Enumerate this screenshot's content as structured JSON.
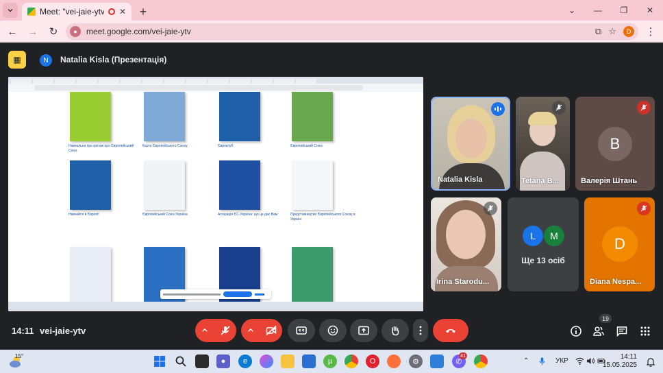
{
  "browser": {
    "tab_title": "Meet: \"vei-jaie-ytv\"",
    "url": "meet.google.com/vei-jaie-ytv",
    "profile_initial": "D"
  },
  "meet": {
    "presenter_initial": "N",
    "presenter_label": "Natalia Kisla (Презентація)",
    "time": "14:11",
    "meeting_code": "vei-jaie-ytv",
    "participant_count": "19"
  },
  "shared_screen": {
    "books": [
      {
        "label": "Навчальна гра орігамі про Європейський Союз",
        "color": "#9acd32"
      },
      {
        "label": "Карта Європейського Союзу",
        "color": "#7fa9d6"
      },
      {
        "label": "Євроклуб",
        "color": "#1f5fa8"
      },
      {
        "label": "Європейський Союз",
        "color": "#6aa84f"
      },
      {
        "label": "Навчайся в Європі!",
        "color": "#1f5fa8"
      },
      {
        "label": "Європейський Союз Україна",
        "color": "#f1f3f6"
      },
      {
        "label": "Асоціація ЄС-Україна: що це дає Вам",
        "color": "#1f4fa0"
      },
      {
        "label": "Представництво Європейського Союзу в Україні",
        "color": "#f4f6fa"
      },
      {
        "label": "",
        "color": "#e9eef6"
      },
      {
        "label": "",
        "color": "#2a6fc1"
      },
      {
        "label": "",
        "color": "#1a3f8c"
      },
      {
        "label": "",
        "color": "#3c9b6b"
      }
    ]
  },
  "participants": [
    {
      "name": "Natalia Kisla",
      "state": "speaking"
    },
    {
      "name": "Tetana B...",
      "state": "muted"
    },
    {
      "name": "Валерія Штань",
      "initial": "B",
      "state": "muted"
    },
    {
      "name": "Irina Starodu...",
      "state": "muted"
    },
    {
      "name": "Ще 13 осіб",
      "initials": [
        "L",
        "M"
      ]
    },
    {
      "name": "Diana Nespa...",
      "initial": "D",
      "state": "muted"
    }
  ],
  "taskbar": {
    "temperature": "15°",
    "language": "УКР",
    "time": "14:11",
    "date": "15.05.2025",
    "viber_badge": "41"
  },
  "colors": {
    "accent": "#1a73e8",
    "danger": "#ea4335",
    "meet_bg": "#202124"
  }
}
